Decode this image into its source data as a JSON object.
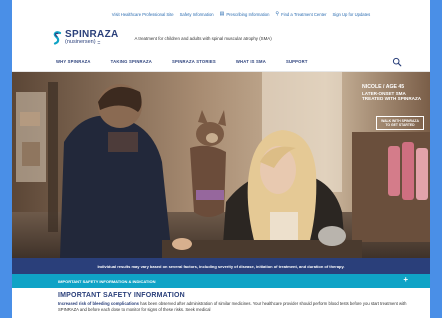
{
  "utility": {
    "links": [
      {
        "label": "Visit Healthcare Professional Site",
        "icon": ""
      },
      {
        "label": "Safety Information",
        "icon": ""
      },
      {
        "label": "Prescribing Information",
        "icon": "document-icon"
      },
      {
        "label": "Find a Treatment Center",
        "icon": "location-pin-icon"
      },
      {
        "label": "Sign Up for Updates",
        "icon": ""
      }
    ]
  },
  "brand": {
    "name": "SPINRAZA",
    "generic": "(nusinersen)",
    "tagline": "A treatment for children and adults with spinal muscular atrophy (SMA)"
  },
  "nav": {
    "items": [
      "WHY SPINRAZA",
      "TAKING SPINRAZA",
      "SPINRAZA STORIES",
      "WHAT IS SMA",
      "SUPPORT"
    ]
  },
  "hero": {
    "caption_name": "NICOLE / AGE 45",
    "caption_line2": "LATER-ONSET SMA",
    "caption_line3": "TREATED WITH SPINRAZA",
    "cta": "WALK WITH SPINRAZA TO GET STARTED"
  },
  "disclaimer": "Individual results may vary based on several factors, including severity of disease, initiation of treatment, and duration of therapy.",
  "isi": {
    "bar_label": "IMPORTANT SAFETY INFORMATION & INDICATION",
    "toggle": "+",
    "heading": "IMPORTANT SAFETY INFORMATION",
    "lead": "Increased risk of bleeding complications",
    "body": " has been observed after administration of similar medicines. Your healthcare provider should perform blood tests before you start treatment with SPINRAZA and before each dose to monitor for signs of these risks. Seek medical"
  },
  "colors": {
    "frame": "#4a8fe7",
    "brand_navy": "#2a3f7a",
    "isi_teal": "#0fa3c6"
  }
}
